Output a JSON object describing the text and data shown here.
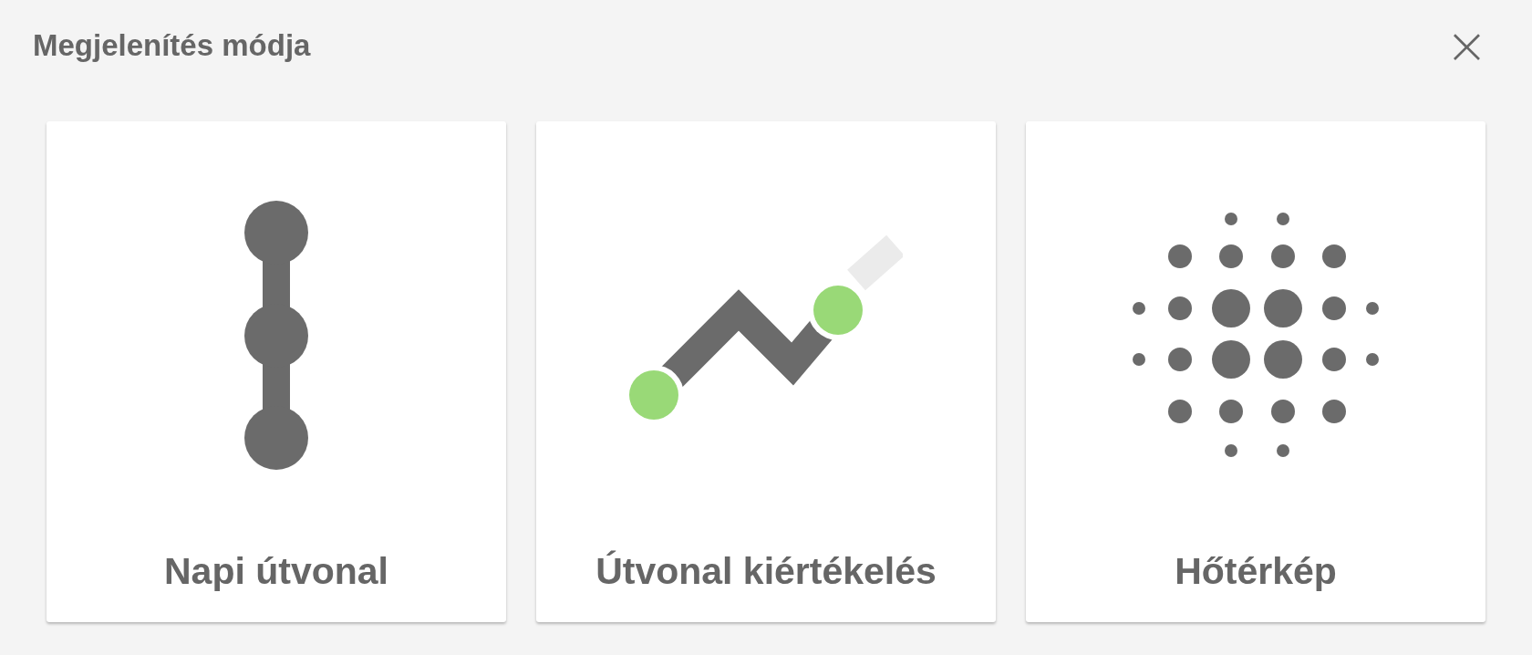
{
  "dialog": {
    "title": "Megjelenítés módja",
    "close": "×"
  },
  "options": [
    {
      "kind": "route",
      "label": "Napi útvonal"
    },
    {
      "kind": "evaluation",
      "label": "Útvonal kiértékelés"
    },
    {
      "kind": "heatmap",
      "label": "Hőtérkép"
    }
  ]
}
